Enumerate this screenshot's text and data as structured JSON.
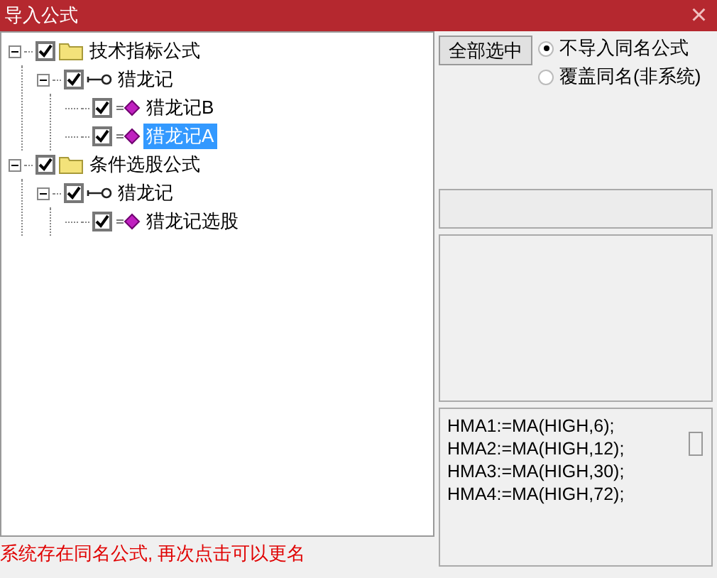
{
  "window": {
    "title": "导入公式",
    "close": "×"
  },
  "tree": [
    {
      "kind": "folder",
      "label": "技术指标公式",
      "checked": true,
      "expanded": true,
      "selected": false,
      "children": [
        {
          "kind": "key",
          "label": "猎龙记",
          "checked": true,
          "expanded": true,
          "selected": false,
          "children": [
            {
              "kind": "formula",
              "label": "猎龙记B",
              "checked": true,
              "selected": false
            },
            {
              "kind": "formula",
              "label": "猎龙记A",
              "checked": true,
              "selected": true
            }
          ]
        }
      ]
    },
    {
      "kind": "folder",
      "label": "条件选股公式",
      "checked": true,
      "expanded": true,
      "selected": false,
      "children": [
        {
          "kind": "key",
          "label": "猎龙记",
          "checked": true,
          "expanded": true,
          "selected": false,
          "children": [
            {
              "kind": "formula",
              "label": "猎龙记选股",
              "checked": true,
              "selected": false
            }
          ]
        }
      ]
    }
  ],
  "select_all_button": "全部选中",
  "options": [
    {
      "label": "不导入同名公式",
      "selected": true
    },
    {
      "label": "覆盖同名(非系统)",
      "selected": false
    }
  ],
  "code_lines": [
    "HMA1:=MA(HIGH,6);",
    "HMA2:=MA(HIGH,12);",
    "HMA3:=MA(HIGH,30);",
    "HMA4:=MA(HIGH,72);"
  ],
  "status": "系统存在同名公式, 再次点击可以更名"
}
